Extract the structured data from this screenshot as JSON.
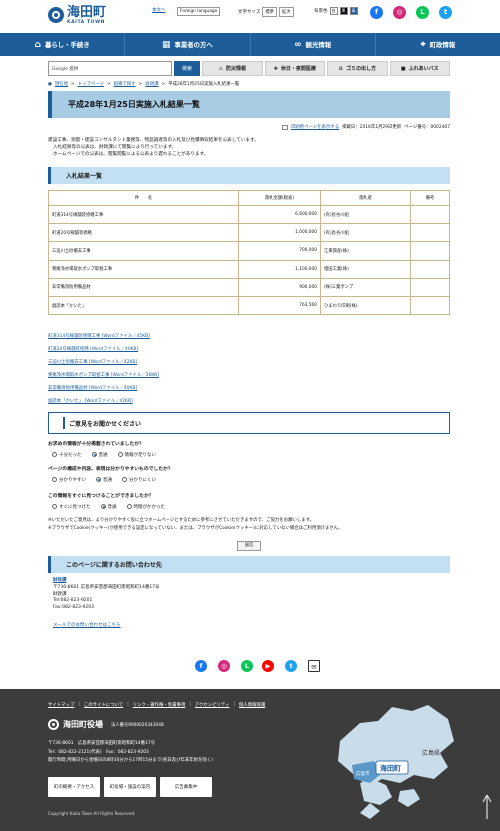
{
  "header": {
    "logo_jp": "海田町",
    "logo_en": "KAITA TOWN",
    "honbun": "本文へ",
    "language": "Foreign language",
    "text_size_label": "文字サイズ",
    "size_standard": "標準",
    "size_large": "拡大",
    "bg_color_label": "背景色",
    "bg_options": [
      "白",
      "黒",
      "青"
    ]
  },
  "sns_top": [
    {
      "name": "facebook-icon",
      "color": "#1877f2",
      "glyph": "f"
    },
    {
      "name": "instagram-icon",
      "color": "#d6287a",
      "glyph": "◎"
    },
    {
      "name": "line-icon",
      "color": "#06c755",
      "glyph": "L"
    },
    {
      "name": "twitter-icon",
      "color": "#1da1f2",
      "glyph": "t"
    }
  ],
  "nav": [
    {
      "label": "暮らし・手続き",
      "icon": "house-icon",
      "glyph": "⌂"
    },
    {
      "label": "事業者の方へ",
      "icon": "building-icon",
      "glyph": "▦"
    },
    {
      "label": "観光情報",
      "icon": "binoculars-icon",
      "glyph": "∞"
    },
    {
      "label": "町政情報",
      "icon": "town-hall-icon",
      "glyph": "⌖"
    }
  ],
  "search": {
    "placeholder": "Google 提供",
    "button": "検索"
  },
  "quick": [
    {
      "label": "防災情報",
      "icon": "warning-icon",
      "glyph": "⚠"
    },
    {
      "label": "休日・夜間医療",
      "icon": "hospital-icon",
      "glyph": "✚"
    },
    {
      "label": "ゴミの出し方",
      "icon": "trash-icon",
      "glyph": "♻"
    },
    {
      "label": "ふれあいバス",
      "icon": "bus-icon",
      "glyph": "■"
    }
  ],
  "breadcrumb": {
    "current_place": "現在地",
    "items": [
      "トップページ",
      "組織で探す",
      "財政課"
    ],
    "current": "平成28年1月25日実施入札結果一覧"
  },
  "page": {
    "title": "平成28年1月25日実施入札結果一覧",
    "print": "印刷用ページを表示する",
    "updated": "掲載日：2016年1月29日更新",
    "page_no": "ページ番号：0002467",
    "intro": [
      "建設工事、測量・建設コンサルタント業務等、物品調達等の入札及び見積徴収結果を公表しています。",
      "入札結果等の公表は、財政課にて閲覧により行っています。",
      "ホームページでの公表は、閲覧閲覧による公表より遅れることがあります。"
    ]
  },
  "results": {
    "heading": "入札結果一覧",
    "columns": [
      "件　　名",
      "落札金額(税抜)",
      "落札者",
      "備考"
    ],
    "rows": [
      [
        "町道314号線舗装修繕工事",
        "6,600,000",
        "(有)長谷川組",
        ""
      ],
      [
        "町道20号線舗装修繕",
        "1,000,000",
        "(有)長谷川組",
        ""
      ],
      [
        "三迫川土砂撤去工事",
        "700,000",
        "江東興産(株)",
        ""
      ],
      [
        "鷲尾浄水場取水ポンプ取替工事",
        "1,100,000",
        "億田工業(株)",
        ""
      ],
      [
        "非常備消防用備品材",
        "900,000",
        "(株)三葉ポンプ",
        ""
      ],
      [
        "副読本「かいた」",
        "763,560",
        "ひまわり印刷(株)",
        ""
      ]
    ]
  },
  "files": [
    "町道314号線舗装修繕工事 [Wordファイル／45KB]",
    "町道20号線舗装修繕 [Wordファイル／40KB]",
    "三迫川土砂撤去工事 [Wordファイル／42KB]",
    "鷲尾浄水場取水ポンプ取替工事 [Wordファイル／36KB]",
    "非常備消防用備品材 [Wordファイル／40KB]",
    "副読本「かいた」 [Wordファイル／47KB]"
  ],
  "survey": {
    "heading": "ご意見をお聞かせください",
    "q1": "お求めの情報が十分掲載されていましたか？",
    "q1_opts": [
      "十分だった",
      "普通",
      "情報が足りない"
    ],
    "q2": "ページの構成や内容、表現は分かりやすいものでしたか？",
    "q2_opts": [
      "分かりやすい",
      "普通",
      "分かりにくい"
    ],
    "q3": "この情報をすぐに見つけることができましたか？",
    "q3_opts": [
      "すぐに見つけた",
      "普通",
      "時間がかかった"
    ],
    "note1": "※いただいたご意見は、より分かりやすく役に立つホームページとするために参考にさせていただきますので、ご協力をお願いします。",
    "note2": "※ブラウザでCookie(クッキー)が使用できる設定になっていない、または、ブラウザがCookie(クッキー)に対応していない場合はご利用頂けません。",
    "send": "送信"
  },
  "contact": {
    "heading": "このページに関するお問い合わせ先",
    "dept": "財政課",
    "address": "〒736-8601 広島県安芸郡海田町南昭和町14番17号",
    "dept2": "財政課",
    "tel": "Tel:082-823-9201",
    "fax": "Fax:082-823-9203",
    "mailform": "メールでのお問い合わせはこちら"
  },
  "sns_bottom": [
    {
      "name": "facebook-icon",
      "color": "#1877f2",
      "glyph": "f"
    },
    {
      "name": "instagram-icon",
      "color": "#d6287a",
      "glyph": "◎"
    },
    {
      "name": "line-icon",
      "color": "#06c755",
      "glyph": "L"
    },
    {
      "name": "youtube-icon",
      "color": "#ff0000",
      "glyph": "▶"
    },
    {
      "name": "twitter-icon",
      "color": "#1da1f2",
      "glyph": "t"
    },
    {
      "name": "mail-icon",
      "color": "#ffffff",
      "glyph": "✉"
    }
  ],
  "footer": {
    "links": [
      "サイトマップ",
      "このサイトについて",
      "リンク・著作権・免責事項",
      "アクセシビリティ",
      "個人情報保護"
    ],
    "town_office": "海田町役場",
    "corp_no": "法人番号9000020343048",
    "address": "〒736-8601　広島県安芸郡海田町南昭和町14番17号",
    "tel": "Tel：082-822-2121(代表)　Fax：082-823-9203",
    "hours": "開庁時間:月曜日から金曜日の8時30分から17時15分まで(祝日及び年末年始を除く)",
    "buttons": [
      "町の概要・アクセス",
      "町役場・施設の案内",
      "広告募集中"
    ],
    "copyright": "Copyright Kaita Town All Rights Reserved.",
    "map_pref": "広島県",
    "map_city": "広島市",
    "map_town": "海田町"
  },
  "colors": {
    "brand": "#1d5d99",
    "title_bg": "#a8cce4",
    "footer_bg": "#3c3c3c"
  }
}
